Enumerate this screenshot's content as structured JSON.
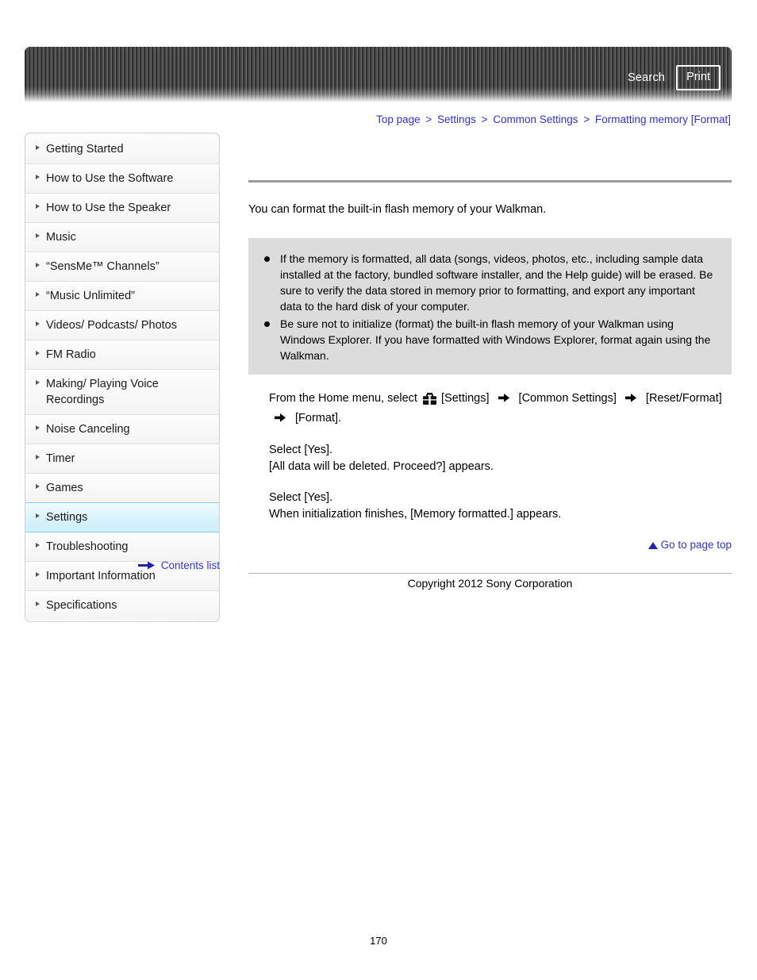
{
  "header": {
    "search_label": "Search",
    "print_label": "Print"
  },
  "breadcrumb": {
    "separator": ">",
    "items": [
      {
        "label": "Top page"
      },
      {
        "label": "Settings"
      },
      {
        "label": "Common Settings"
      },
      {
        "label": "Formatting memory [Format]"
      }
    ]
  },
  "sidebar": {
    "items": [
      {
        "label": "Getting Started",
        "active": false
      },
      {
        "label": "How to Use the Software",
        "active": false
      },
      {
        "label": "How to Use the Speaker",
        "active": false
      },
      {
        "label": "Music",
        "active": false
      },
      {
        "label": "“SensMe™ Channels”",
        "active": false
      },
      {
        "label": "“Music Unlimited”",
        "active": false
      },
      {
        "label": "Videos/ Podcasts/ Photos",
        "active": false
      },
      {
        "label": "FM Radio",
        "active": false
      },
      {
        "label": "Making/ Playing Voice Recordings",
        "active": false
      },
      {
        "label": "Noise Canceling",
        "active": false
      },
      {
        "label": "Timer",
        "active": false
      },
      {
        "label": "Games",
        "active": false
      },
      {
        "label": "Settings",
        "active": true
      },
      {
        "label": "Troubleshooting",
        "active": false
      },
      {
        "label": "Important Information",
        "active": false
      },
      {
        "label": "Specifications",
        "active": false
      }
    ],
    "contents_list_label": "Contents list"
  },
  "main": {
    "intro": "You can format the built-in flash memory of your Walkman.",
    "notes": [
      "If the memory is formatted, all data (songs, videos, photos, etc., including sample data installed at the factory, bundled software installer, and the Help guide) will be erased. Be sure to verify the data stored in memory prior to formatting, and export any important data to the hard disk of your computer.",
      "Be sure not to initialize (format) the built-in flash memory of your Walkman using Windows Explorer. If you have formatted with Windows Explorer, format again using the Walkman."
    ],
    "step1": {
      "lead": "From the Home menu, select",
      "item1": "[Settings]",
      "item2": "[Common Settings]",
      "item3": "[Reset/Format]",
      "item4": "[Format]."
    },
    "step2": {
      "line1": "Select [Yes].",
      "line2": "[All data will be deleted. Proceed?] appears."
    },
    "step3": {
      "line1": "Select [Yes].",
      "line2": "When initialization finishes, [Memory formatted.] appears."
    },
    "page_top_label": "Go to page top"
  },
  "footer": {
    "copyright": "Copyright 2012 Sony Corporation",
    "page_number": "170"
  },
  "colors": {
    "link_blue": "#3333cc",
    "active_cyan": "#7fd4ec",
    "note_bg": "#dcdcdc",
    "rule_gray": "#9c9c9c"
  }
}
